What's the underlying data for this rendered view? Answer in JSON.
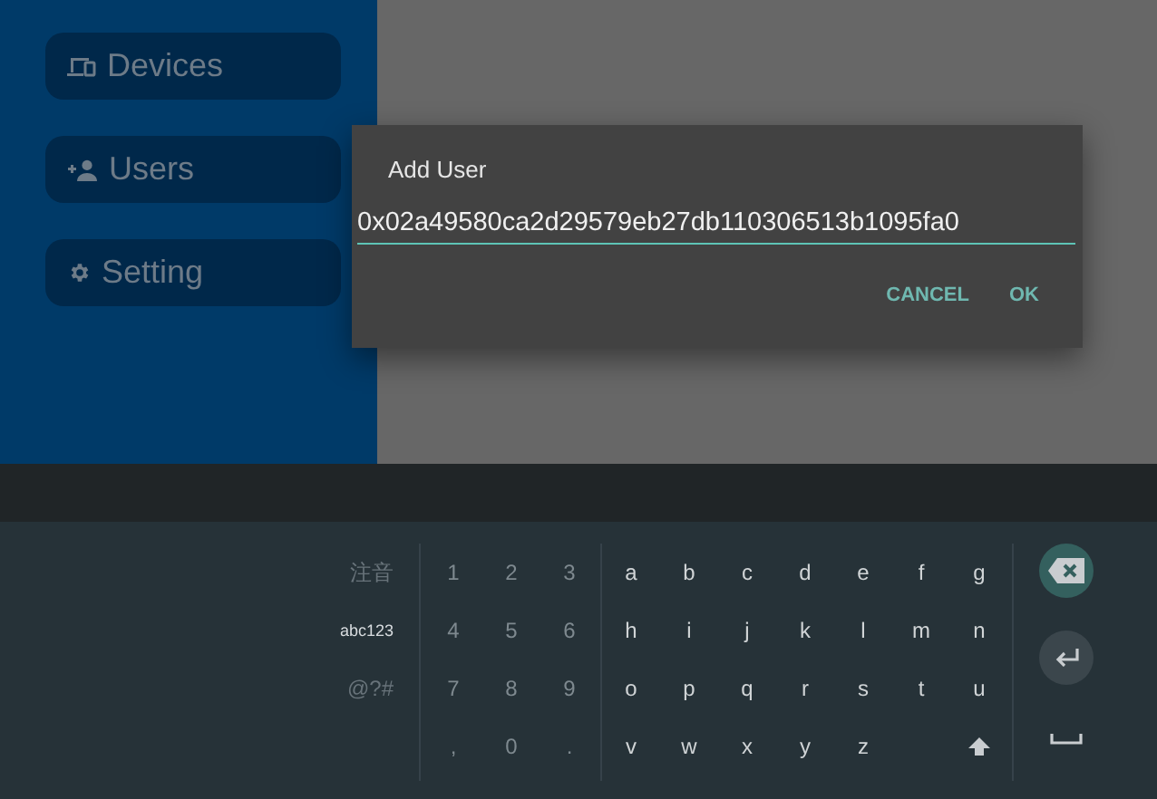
{
  "sidebar": {
    "items": [
      {
        "label": "Devices",
        "kind": "devices"
      },
      {
        "label": "Users",
        "kind": "users"
      },
      {
        "label": "Setting",
        "kind": "setting"
      }
    ]
  },
  "dialog": {
    "title": "Add User",
    "value": "0x02a49580ca2d29579eb27db110306513b1095fa0",
    "buttons": [
      "CANCEL",
      "OK"
    ]
  },
  "keyboard": {
    "modes": [
      {
        "label": "注音",
        "selected": false
      },
      {
        "label": "abc123",
        "selected": true
      },
      {
        "label": "@?#",
        "selected": false
      }
    ],
    "number_rows": [
      [
        "1",
        "2",
        "3"
      ],
      [
        "4",
        "5",
        "6"
      ],
      [
        "7",
        "8",
        "9"
      ],
      [
        ",",
        "0",
        "."
      ]
    ],
    "letter_rows": [
      [
        "a",
        "b",
        "c",
        "d",
        "e",
        "f",
        "g"
      ],
      [
        "h",
        "i",
        "j",
        "k",
        "l",
        "m",
        "n"
      ],
      [
        "o",
        "p",
        "q",
        "r",
        "s",
        "t",
        "u"
      ],
      [
        "v",
        "w",
        "x",
        "y",
        "z"
      ]
    ],
    "actions": [
      {
        "kind": "backspace"
      },
      {
        "kind": "enter"
      },
      {
        "kind": "space"
      }
    ]
  }
}
